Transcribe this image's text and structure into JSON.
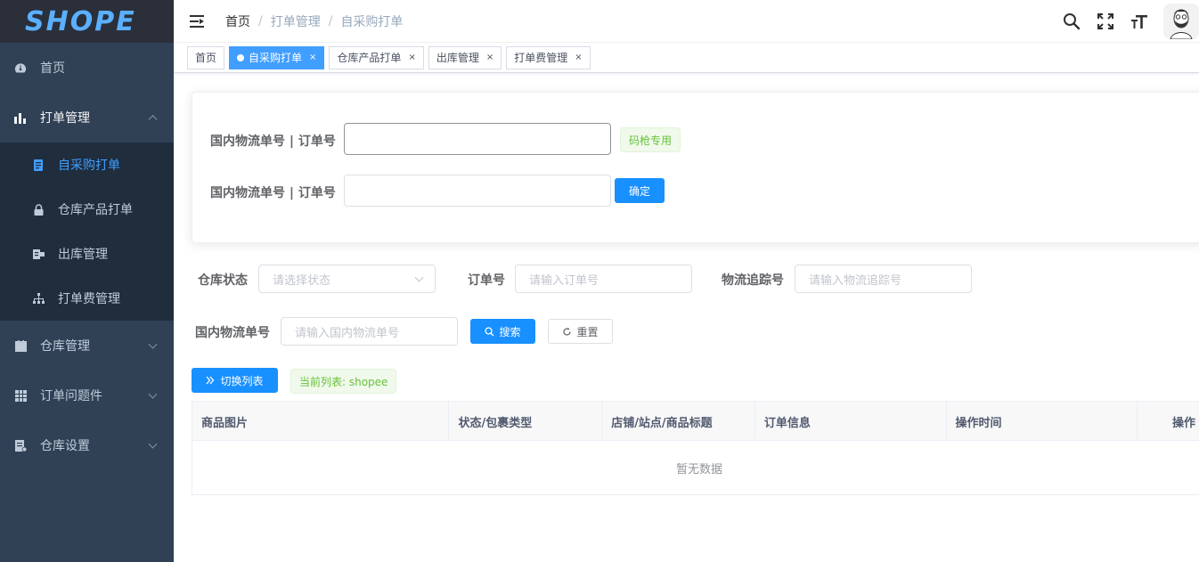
{
  "logo": "SHOPE",
  "sidebar": {
    "items": [
      {
        "label": "首页",
        "icon": "dashboard-icon"
      },
      {
        "label": "打单管理",
        "icon": "chart-icon",
        "open": true,
        "children": [
          {
            "label": "自采购打单",
            "icon": "list-icon",
            "active": true
          },
          {
            "label": "仓库产品打单",
            "icon": "lock-icon"
          },
          {
            "label": "出库管理",
            "icon": "export-icon"
          },
          {
            "label": "打单费管理",
            "icon": "tree-icon"
          }
        ]
      },
      {
        "label": "仓库管理",
        "icon": "clipboard-icon"
      },
      {
        "label": "订单问题件",
        "icon": "table-icon"
      },
      {
        "label": "仓库设置",
        "icon": "settings-doc-icon"
      }
    ]
  },
  "header": {
    "breadcrumb": [
      "首页",
      "打单管理",
      "自采购打单"
    ]
  },
  "tags": [
    {
      "label": "首页",
      "closable": false,
      "active": false
    },
    {
      "label": "自采购打单",
      "closable": true,
      "active": true
    },
    {
      "label": "仓库产品打单",
      "closable": true,
      "active": false
    },
    {
      "label": "出库管理",
      "closable": true,
      "active": false
    },
    {
      "label": "打单费管理",
      "closable": true,
      "active": false
    }
  ],
  "scan_form": {
    "label1": "国内物流单号 | 订单号",
    "scanner_tag": "码枪专用",
    "label2": "国内物流单号 | 订单号",
    "confirm": "确定"
  },
  "filters": {
    "status_label": "仓库状态",
    "status_placeholder": "请选择状态",
    "order_label": "订单号",
    "order_placeholder": "请输入订单号",
    "tracking_label": "物流追踪号",
    "tracking_placeholder": "请输入物流追踪号",
    "domestic_label": "国内物流单号",
    "domestic_placeholder": "请输入国内物流单号",
    "search": "搜索",
    "reset": "重置"
  },
  "toolbar": {
    "switch_list": "切换列表",
    "current_list": "当前列表: shopee"
  },
  "table": {
    "columns": [
      "商品图片",
      "状态/包裹类型",
      "店铺/站点/商品标题",
      "订单信息",
      "操作时间",
      "操作"
    ],
    "empty": "暂无数据"
  },
  "close_glyph": "×"
}
